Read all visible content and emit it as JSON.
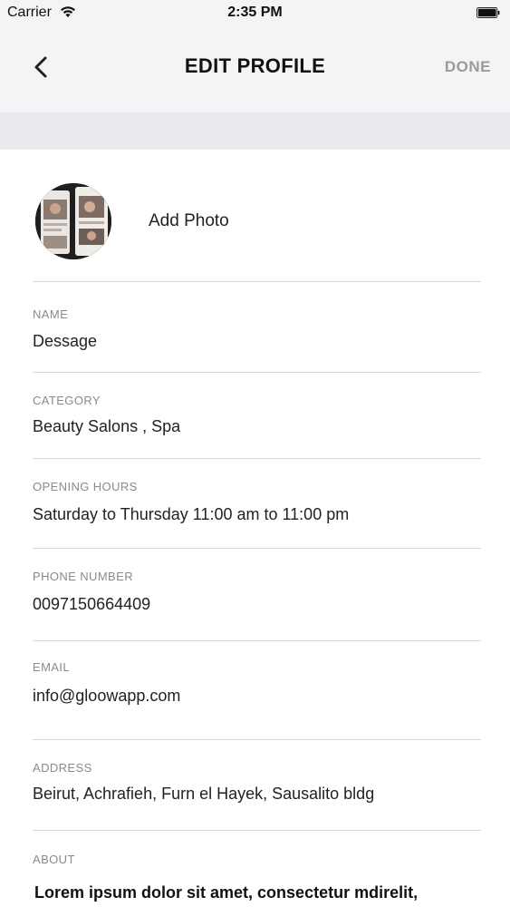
{
  "status_bar": {
    "carrier": "Carrier",
    "time": "2:35 PM",
    "wifi_icon": "wifi-icon",
    "battery_icon": "battery-icon"
  },
  "nav": {
    "back_icon": "chevron-left-icon",
    "title": "EDIT PROFILE",
    "done_label": "DONE"
  },
  "profile_photo": {
    "add_photo_label": "Add Photo"
  },
  "fields": {
    "name": {
      "label": "NAME",
      "value": "Dessage"
    },
    "category": {
      "label": "CATEGORY",
      "value": "Beauty Salons , Spa"
    },
    "opening_hours": {
      "label": "OPENING HOURS",
      "value": "Saturday to Thursday 11:00 am to 11:00 pm"
    },
    "phone": {
      "label": "PHONE NUMBER",
      "value": "0097150664409"
    },
    "email": {
      "label": "EMAIL",
      "value": "info@gloowapp.com"
    },
    "address": {
      "label": "ADDRESS",
      "value": "Beirut, Achrafieh, Furn el Hayek, Sausalito bldg"
    },
    "about": {
      "label": "ABOUT",
      "value": "Lorem ipsum dolor sit amet, consectetur mdirelit,"
    }
  },
  "colors": {
    "nav_background": "#f4f3f6",
    "band_background": "#ebeaee",
    "label_gray": "#8a8a8a",
    "done_gray": "#9b9b9b",
    "divider": "#d8d8d8"
  }
}
